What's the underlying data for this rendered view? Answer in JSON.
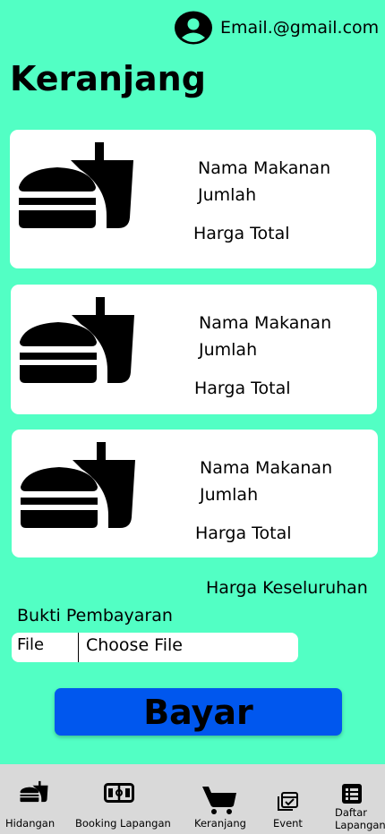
{
  "header": {
    "email": "Email.@gmail.com",
    "avatar_icon": "account-circle-icon"
  },
  "page": {
    "title": "Keranjang"
  },
  "cart_items": [
    {
      "name": "Nama Makanan",
      "quantity": "Jumlah",
      "total": "Harga Total",
      "icon": "fastfood-icon"
    },
    {
      "name": "Nama Makanan",
      "quantity": "Jumlah",
      "total": "Harga Total",
      "icon": "fastfood-icon"
    },
    {
      "name": "Nama Makanan",
      "quantity": "Jumlah",
      "total": "Harga Total",
      "icon": "fastfood-icon"
    }
  ],
  "summary": {
    "grand_total_label": "Harga Keseluruhan"
  },
  "payment": {
    "proof_label": "Bukti Pembayaran",
    "file_label": "File",
    "choose_file": "Choose File"
  },
  "pay_button": {
    "label": "Bayar",
    "color": "#0057ee"
  },
  "bottom_nav": [
    {
      "label": "Hidangan",
      "icon": "fastfood-icon"
    },
    {
      "label": "Booking Lapangan",
      "icon": "stadium-icon"
    },
    {
      "label": "Keranjang",
      "icon": "cart-icon"
    },
    {
      "label": "Event",
      "icon": "event-calendar-icon"
    },
    {
      "label": "Daftar Lapangan",
      "icon": "list-icon"
    }
  ],
  "colors": {
    "background": "#52ffc4",
    "card": "#ffffff",
    "nav_bar": "#d9d9d9"
  }
}
